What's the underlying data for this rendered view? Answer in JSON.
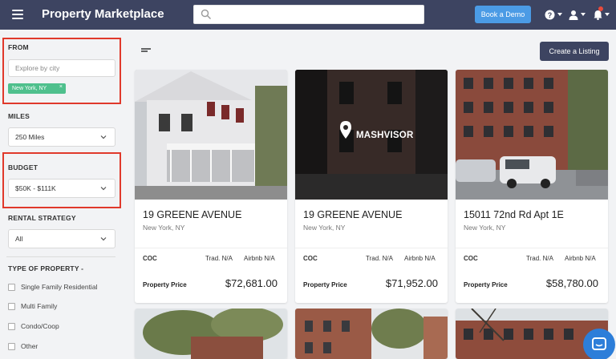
{
  "header": {
    "title": "Property Marketplace",
    "search_placeholder": "",
    "demo_label": "Book a Demo",
    "icons": [
      "menu-icon",
      "search-icon",
      "help-icon",
      "user-icon",
      "bell-icon"
    ]
  },
  "sidebar": {
    "from": {
      "title": "FROM",
      "placeholder": "Explore by city",
      "chip": "New York, NY",
      "chip_close": "×"
    },
    "miles": {
      "title": "MILES",
      "value": "250 Miles"
    },
    "budget": {
      "title": "BUDGET",
      "value": "$50K - $111K"
    },
    "rental": {
      "title": "RENTAL STRATEGY",
      "value": "All"
    },
    "type": {
      "title": "TYPE OF PROPERTY -",
      "options": [
        "Single Family Residential",
        "Multi Family",
        "Condo/Coop",
        "Other"
      ]
    },
    "colors": {
      "highlight": "#e0392b",
      "chip": "#4fc08d"
    }
  },
  "main": {
    "create_label": "Create a Listing",
    "cards": [
      {
        "address": "19 GREENE AVENUE",
        "city": "New York, NY",
        "coc_label": "COC",
        "trad": "Trad. N/A",
        "airbnb": "Airbnb N/A",
        "price_label": "Property Price",
        "price": "$72,681.00"
      },
      {
        "address": "19 GREENE AVENUE",
        "city": "New York, NY",
        "coc_label": "COC",
        "trad": "Trad. N/A",
        "airbnb": "Airbnb N/A",
        "price_label": "Property Price",
        "price": "$71,952.00",
        "watermark": "MASHVISOR"
      },
      {
        "address": "15011 72nd Rd Apt 1E",
        "city": "New York, NY",
        "coc_label": "COC",
        "trad": "Trad. N/A",
        "airbnb": "Airbnb N/A",
        "price_label": "Property Price",
        "price": "$58,780.00"
      }
    ]
  }
}
